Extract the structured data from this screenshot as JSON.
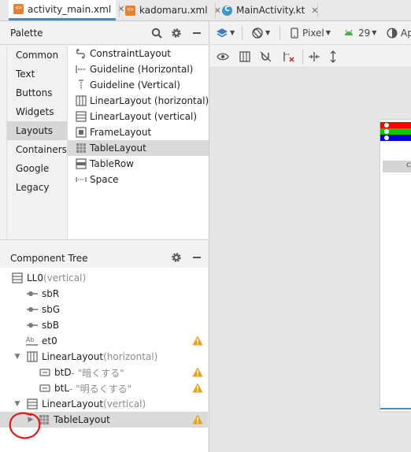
{
  "tabs": [
    {
      "label": "activity_main.xml",
      "icon": "xml-file-icon",
      "active": true
    },
    {
      "label": "kadomaru.xml",
      "icon": "xml-file-icon",
      "active": false
    },
    {
      "label": "MainActivity.kt",
      "icon": "kotlin-class-icon",
      "active": false
    }
  ],
  "palette": {
    "title": "Palette",
    "categories": [
      "Common",
      "Text",
      "Buttons",
      "Widgets",
      "Layouts",
      "Containers",
      "Google",
      "Legacy"
    ],
    "selected_category": "Layouts",
    "items": [
      {
        "label": "ConstraintLayout",
        "icon": "constraint-layout-icon"
      },
      {
        "label": "Guideline (Horizontal)",
        "icon": "guideline-horizontal-icon"
      },
      {
        "label": "Guideline (Vertical)",
        "icon": "guideline-vertical-icon"
      },
      {
        "label": "LinearLayout (horizontal)",
        "icon": "linear-layout-horizontal-icon"
      },
      {
        "label": "LinearLayout (vertical)",
        "icon": "linear-layout-vertical-icon"
      },
      {
        "label": "FrameLayout",
        "icon": "frame-layout-icon"
      },
      {
        "label": "TableLayout",
        "icon": "table-layout-icon"
      },
      {
        "label": "TableRow",
        "icon": "table-row-icon"
      },
      {
        "label": "Space",
        "icon": "space-icon"
      }
    ],
    "selected_item": "TableLayout"
  },
  "component_tree": {
    "title": "Component Tree",
    "rows": [
      {
        "id": "LL0",
        "type": "(vertical)",
        "icon": "linear-layout-vertical-icon"
      },
      {
        "id": "sbR",
        "icon": "seekbar-icon"
      },
      {
        "id": "sbG",
        "icon": "seekbar-icon"
      },
      {
        "id": "sbB",
        "icon": "seekbar-icon"
      },
      {
        "id": "et0",
        "icon": "text-field-icon",
        "warning": true
      },
      {
        "id": "LinearLayout",
        "type": "(horizontal)",
        "icon": "linear-layout-horizontal-icon",
        "expanded": true
      },
      {
        "id": "btD",
        "text": "- \"暗くする\"",
        "icon": "button-icon",
        "warning": true
      },
      {
        "id": "btL",
        "text": "- \"明るくする\"",
        "icon": "button-icon",
        "warning": true
      },
      {
        "id": "LinearLayout",
        "type": "(vertical)",
        "icon": "linear-layout-vertical-icon",
        "expanded": true
      },
      {
        "id": "TableLayout",
        "icon": "table-layout-icon",
        "warning": true,
        "selected": true,
        "expanded": false
      }
    ]
  },
  "design_toolbar": {
    "device": "Pixel",
    "api_level": "29",
    "theme_prefix": "Ap"
  },
  "preview": {
    "seekbar_colors": [
      "#ff0000",
      "#00cc00",
      "#0000cc"
    ]
  },
  "colors": {
    "accent": "#4a88c7",
    "warning": "#e8a317",
    "annotation": "#e01b1b",
    "selection": "#dadada"
  }
}
